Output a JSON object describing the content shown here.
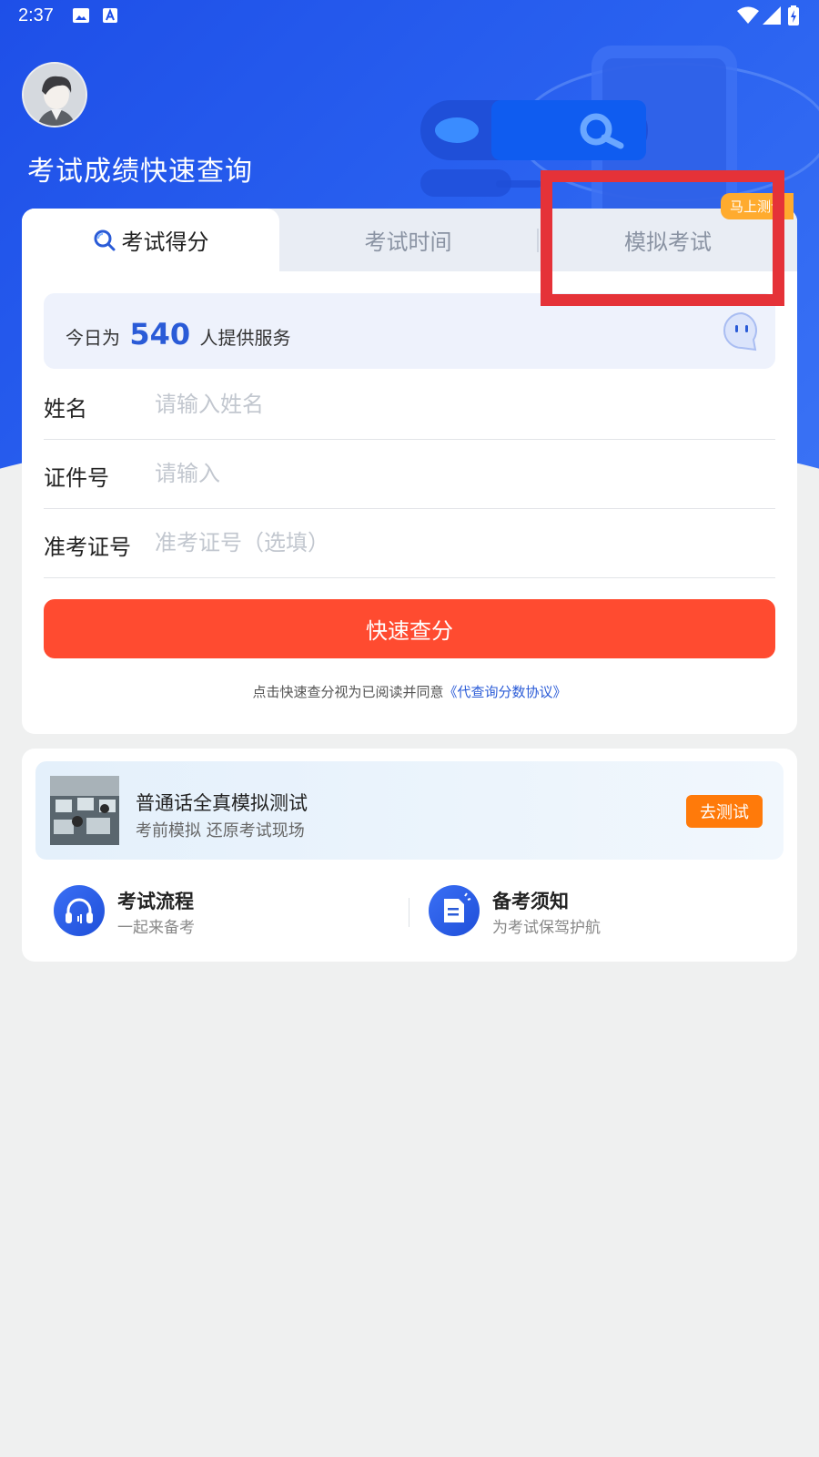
{
  "status_bar": {
    "time": "2:37"
  },
  "header": {
    "title": "考试成绩快速查询"
  },
  "tabs": [
    {
      "label": "考试得分",
      "active": true
    },
    {
      "label": "考试时间",
      "active": false
    },
    {
      "label": "模拟考试",
      "active": false,
      "badge": "马上测试"
    }
  ],
  "service": {
    "prefix": "今日为",
    "count": "540",
    "suffix": "人提供服务"
  },
  "form": {
    "name_label": "姓名",
    "name_placeholder": "请输入姓名",
    "id_label": "证件号",
    "id_placeholder": "请输入",
    "ticket_label": "准考证号",
    "ticket_placeholder": "准考证号（选填）"
  },
  "submit_label": "快速查分",
  "agreement": {
    "text": "点击快速查分视为已阅读并同意",
    "link": "《代查询分数协议》"
  },
  "promo": {
    "title": "普通话全真模拟测试",
    "subtitle": "考前模拟  还原考试现场",
    "button": "去测试"
  },
  "quick_links": [
    {
      "title": "考试流程",
      "subtitle": "一起来备考",
      "icon": "headset-icon"
    },
    {
      "title": "备考须知",
      "subtitle": "为考试保驾护航",
      "icon": "document-icon"
    }
  ],
  "colors": {
    "primary": "#2a5bd7",
    "submit": "#ff4b30",
    "promo_button": "#ff7a0a",
    "badge": "#ffab2e",
    "highlight": "#e53238"
  }
}
